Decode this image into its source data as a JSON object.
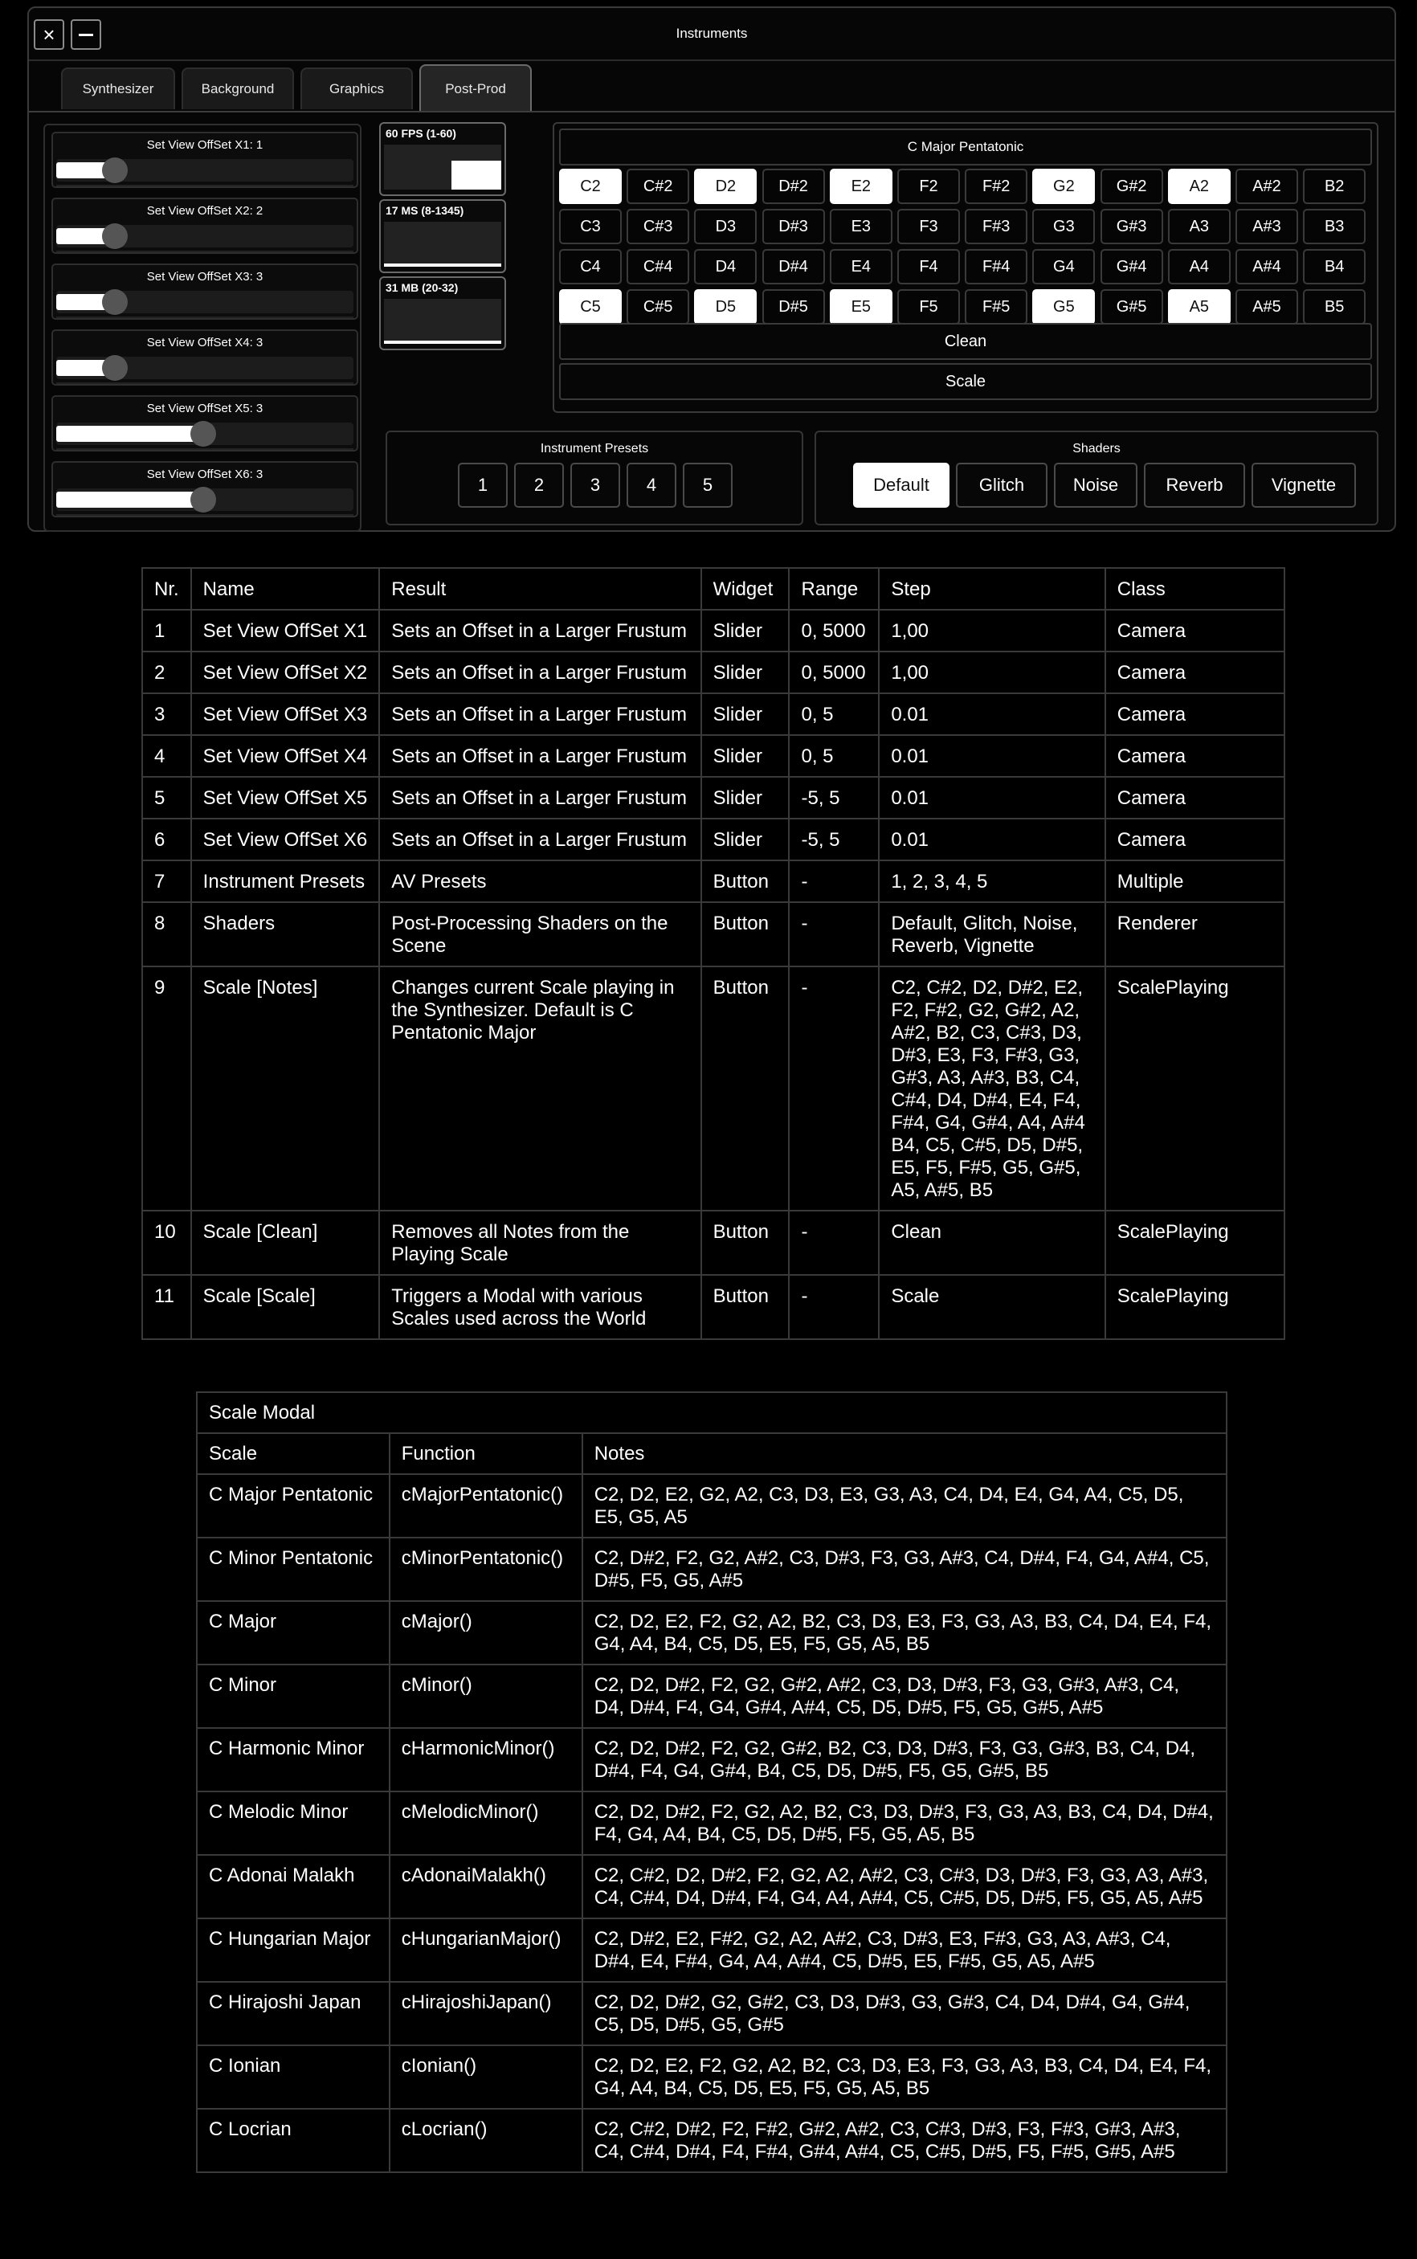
{
  "window": {
    "title": "Instruments",
    "close_icon": "×"
  },
  "tabs": [
    {
      "label": "Synthesizer",
      "active": false
    },
    {
      "label": "Background",
      "active": false
    },
    {
      "label": "Graphics",
      "active": false
    },
    {
      "label": "Post-Prod",
      "active": true
    }
  ],
  "sliders": [
    {
      "label": "Set View OffSet X1:  1",
      "level": 0.2
    },
    {
      "label": "Set View OffSet X2:  2",
      "level": 0.2
    },
    {
      "label": "Set View OffSet X3:  3",
      "level": 0.2
    },
    {
      "label": "Set View OffSet X4:  3",
      "level": 0.2
    },
    {
      "label": "Set View OffSet X5:  3",
      "level": 0.5
    },
    {
      "label": "Set View OffSet X6:  3",
      "level": 0.5
    }
  ],
  "stats": [
    {
      "label": "60 FPS (1-60)",
      "level": 0.6
    },
    {
      "label": "17 MS (8-1345)",
      "level": 0.05
    },
    {
      "label": "31 MB (20-32)",
      "level": 0.05
    }
  ],
  "scale": {
    "title": "C Major Pentatonic",
    "rows": [
      [
        {
          "n": "C2",
          "on": true
        },
        {
          "n": "C#2",
          "on": false
        },
        {
          "n": "D2",
          "on": true
        },
        {
          "n": "D#2",
          "on": false
        },
        {
          "n": "E2",
          "on": true
        },
        {
          "n": "F2",
          "on": false
        },
        {
          "n": "F#2",
          "on": false
        },
        {
          "n": "G2",
          "on": true
        },
        {
          "n": "G#2",
          "on": false
        },
        {
          "n": "A2",
          "on": true
        },
        {
          "n": "A#2",
          "on": false
        },
        {
          "n": "B2",
          "on": false
        }
      ],
      [
        {
          "n": "C3",
          "on": false
        },
        {
          "n": "C#3",
          "on": false
        },
        {
          "n": "D3",
          "on": false
        },
        {
          "n": "D#3",
          "on": false
        },
        {
          "n": "E3",
          "on": false
        },
        {
          "n": "F3",
          "on": false
        },
        {
          "n": "F#3",
          "on": false
        },
        {
          "n": "G3",
          "on": false
        },
        {
          "n": "G#3",
          "on": false
        },
        {
          "n": "A3",
          "on": false
        },
        {
          "n": "A#3",
          "on": false
        },
        {
          "n": "B3",
          "on": false
        }
      ],
      [
        {
          "n": "C4",
          "on": false
        },
        {
          "n": "C#4",
          "on": false
        },
        {
          "n": "D4",
          "on": false
        },
        {
          "n": "D#4",
          "on": false
        },
        {
          "n": "E4",
          "on": false
        },
        {
          "n": "F4",
          "on": false
        },
        {
          "n": "F#4",
          "on": false
        },
        {
          "n": "G4",
          "on": false
        },
        {
          "n": "G#4",
          "on": false
        },
        {
          "n": "A4",
          "on": false
        },
        {
          "n": "A#4",
          "on": false
        },
        {
          "n": "B4",
          "on": false
        }
      ],
      [
        {
          "n": "C5",
          "on": true
        },
        {
          "n": "C#5",
          "on": false
        },
        {
          "n": "D5",
          "on": true
        },
        {
          "n": "D#5",
          "on": false
        },
        {
          "n": "E5",
          "on": true
        },
        {
          "n": "F5",
          "on": false
        },
        {
          "n": "F#5",
          "on": false
        },
        {
          "n": "G5",
          "on": true
        },
        {
          "n": "G#5",
          "on": false
        },
        {
          "n": "A5",
          "on": true
        },
        {
          "n": "A#5",
          "on": false
        },
        {
          "n": "B5",
          "on": false
        }
      ]
    ],
    "clean_label": "Clean",
    "scale_label": "Scale"
  },
  "presets": {
    "title": "Instrument Presets",
    "items": [
      "1",
      "2",
      "3",
      "4",
      "5"
    ]
  },
  "shaders": {
    "title": "Shaders",
    "items": [
      "Default",
      "Glitch",
      "Noise",
      "Reverb",
      "Vignette"
    ],
    "active": "Default"
  },
  "params_table": {
    "headers": [
      "Nr.",
      "Name",
      "Result",
      "Widget",
      "Range",
      "Step",
      "Class"
    ],
    "rows": [
      [
        "1",
        "Set View OffSet X1",
        "Sets an Offset in a Larger Frustum",
        "Slider",
        "0, 5000",
        "1,00",
        "Camera"
      ],
      [
        "2",
        "Set View OffSet X2",
        "Sets an Offset in a Larger Frustum",
        "Slider",
        "0, 5000",
        "1,00",
        "Camera"
      ],
      [
        "3",
        "Set View OffSet X3",
        "Sets an Offset in a Larger Frustum",
        "Slider",
        "0, 5",
        "0.01",
        "Camera"
      ],
      [
        "4",
        "Set View OffSet X4",
        "Sets an Offset in a Larger Frustum",
        "Slider",
        "0, 5",
        "0.01",
        "Camera"
      ],
      [
        "5",
        "Set View OffSet X5",
        "Sets an Offset in a Larger Frustum",
        "Slider",
        "-5, 5",
        "0.01",
        "Camera"
      ],
      [
        "6",
        "Set View OffSet X6",
        "Sets an Offset in a Larger Frustum",
        "Slider",
        "-5, 5",
        "0.01",
        "Camera"
      ],
      [
        "7",
        "Instrument Presets",
        "AV Presets",
        "Button",
        "-",
        "1, 2, 3, 4, 5",
        "Multiple"
      ],
      [
        "8",
        "Shaders",
        "Post-Processing Shaders on the Scene",
        "Button",
        "-",
        "Default, Glitch, Noise, Reverb, Vignette",
        "Renderer"
      ],
      [
        "9",
        "Scale [Notes]",
        "Changes current Scale playing in the Synthesizer. Default is C Pentatonic Major",
        "Button",
        "-",
        "C2, C#2, D2, D#2, E2, F2, F#2, G2, G#2, A2, A#2, B2, C3, C#3, D3, D#3, E3, F3, F#3, G3, G#3, A3, A#3, B3, C4, C#4, D4, D#4, E4, F4, F#4, G4, G#4, A4, A#4 B4, C5, C#5, D5, D#5, E5, F5, F#5, G5, G#5, A5, A#5, B5",
        "ScalePlaying"
      ],
      [
        "10",
        "Scale [Clean]",
        "Removes all Notes from the Playing Scale",
        "Button",
        "-",
        "Clean",
        "ScalePlaying"
      ],
      [
        "11",
        "Scale [Scale]",
        "Triggers a Modal with various Scales used across the World",
        "Button",
        "-",
        "Scale",
        "ScalePlaying"
      ]
    ]
  },
  "modal_table": {
    "title": "Scale Modal",
    "headers": [
      "Scale",
      "Function",
      "Notes"
    ],
    "rows": [
      [
        "C Major Pentatonic",
        "cMajorPentatonic()",
        "C2, D2, E2, G2, A2, C3, D3, E3, G3, A3, C4, D4, E4, G4, A4, C5, D5, E5, G5, A5"
      ],
      [
        "C Minor Pentatonic",
        "cMinorPentatonic()",
        "C2, D#2, F2, G2, A#2, C3, D#3, F3, G3, A#3, C4, D#4, F4, G4, A#4, C5, D#5, F5, G5, A#5"
      ],
      [
        "C Major",
        "cMajor()",
        "C2, D2, E2, F2, G2, A2, B2, C3, D3, E3, F3, G3, A3, B3, C4, D4, E4, F4, G4, A4, B4, C5, D5, E5, F5, G5, A5, B5"
      ],
      [
        "C Minor",
        "cMinor()",
        "C2, D2, D#2, F2, G2, G#2, A#2, C3, D3, D#3, F3, G3, G#3, A#3, C4, D4, D#4, F4, G4, G#4, A#4, C5, D5, D#5, F5, G5, G#5, A#5"
      ],
      [
        "C Harmonic Minor",
        "cHarmonicMinor()",
        "C2, D2, D#2, F2, G2, G#2, B2, C3, D3, D#3, F3, G3, G#3, B3, C4, D4, D#4, F4, G4, G#4, B4, C5, D5, D#5, F5, G5, G#5, B5"
      ],
      [
        "C Melodic Minor",
        "cMelodicMinor()",
        "C2, D2, D#2, F2, G2, A2, B2, C3, D3, D#3, F3, G3, A3, B3, C4, D4, D#4, F4, G4, A4, B4, C5, D5, D#5, F5, G5, A5, B5"
      ],
      [
        "C Adonai Malakh",
        "cAdonaiMalakh()",
        "C2, C#2, D2, D#2, F2, G2, A2, A#2, C3, C#3, D3, D#3, F3, G3, A3, A#3, C4, C#4, D4, D#4, F4, G4, A4, A#4, C5, C#5, D5, D#5, F5, G5, A5, A#5"
      ],
      [
        "C Hungarian Major",
        "cHungarianMajor()",
        "C2, D#2, E2, F#2, G2, A2, A#2, C3, D#3, E3, F#3, G3, A3, A#3, C4, D#4, E4, F#4, G4, A4, A#4, C5, D#5, E5, F#5, G5, A5, A#5"
      ],
      [
        "C Hirajoshi Japan",
        "cHirajoshiJapan()",
        "C2, D2, D#2, G2, G#2, C3, D3, D#3, G3, G#3, C4, D4, D#4, G4, G#4, C5, D5, D#5, G5, G#5"
      ],
      [
        "C Ionian",
        "cIonian()",
        "C2, D2, E2, F2, G2, A2, B2, C3, D3, E3, F3, G3, A3, B3, C4, D4, E4, F4, G4, A4, B4, C5, D5, E5, F5, G5, A5, B5"
      ],
      [
        "C Locrian",
        "cLocrian()",
        "C2, C#2, D#2, F2, F#2, G#2, A#2, C3, C#3, D#3, F3, F#3, G#3, A#3, C4, C#4, D#4, F4, F#4, G#4, A#4, C5, C#5, D#5, F5, F#5, G#5, A#5"
      ]
    ]
  }
}
